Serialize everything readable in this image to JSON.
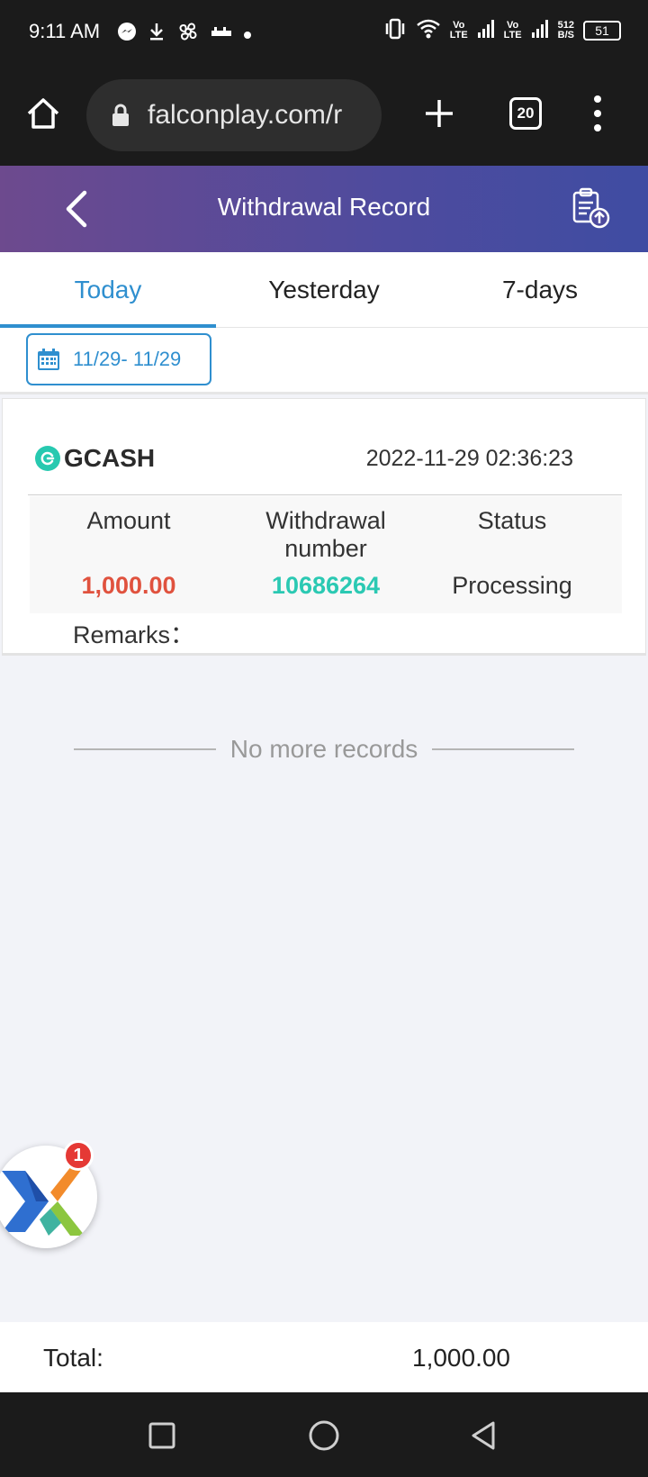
{
  "status_bar": {
    "time": "9:11 AM",
    "lte_label_1": "Vo\nLTE",
    "lte_label_2": "Vo\nLTE",
    "speed": "512\nB/S",
    "battery": "51"
  },
  "browser": {
    "url": "falconplay.com/r",
    "tab_count": "20"
  },
  "header": {
    "title": "Withdrawal Record"
  },
  "tabs": [
    {
      "label": "Today",
      "active": true
    },
    {
      "label": "Yesterday",
      "active": false
    },
    {
      "label": "7-days",
      "active": false
    }
  ],
  "date_filter": {
    "range": "11/29- 11/29"
  },
  "record": {
    "method": "GCASH",
    "datetime": "2022-11-29 02:36:23",
    "headers": {
      "amount": "Amount",
      "number": "Withdrawal number",
      "status": "Status"
    },
    "amount": "1,000.00",
    "number": "10686264",
    "status": "Processing",
    "remarks_label": "Remarks："
  },
  "list_end_text": "No more records",
  "float_badge": "1",
  "total": {
    "label": "Total:",
    "value": "1,000.00"
  },
  "colors": {
    "header_gradient_start": "#6d4a8e",
    "header_gradient_end": "#3f4ca2",
    "accent_blue": "#2f8fcf",
    "amount_red": "#e0523e",
    "number_teal": "#2bc9b3"
  }
}
